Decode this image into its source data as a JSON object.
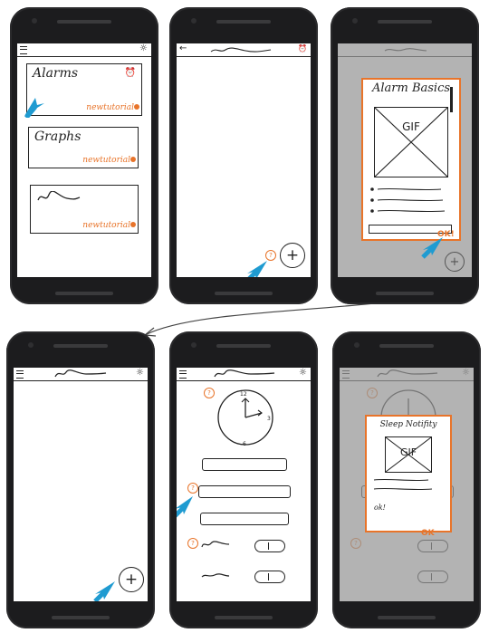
{
  "colors": {
    "accent": "#e8742a",
    "cursor": "#1f9bd1",
    "ink": "#222222",
    "overlay": "#969696"
  },
  "phone1": {
    "cards": [
      {
        "title": "Alarms",
        "link": "newtutorial",
        "icon": "alarm-clock-icon"
      },
      {
        "title": "Graphs",
        "link": "newtutorial"
      },
      {
        "title": "",
        "link": "newtutorial"
      }
    ]
  },
  "phone2": {
    "help": "?",
    "fab": "+"
  },
  "phone3": {
    "modal_title": "Alarm Basics",
    "gif": "GIF",
    "ok": "OK!",
    "fab": "+"
  },
  "phone4": {
    "fab": "+"
  },
  "phone5": {
    "help": "?",
    "clock_numbers": [
      "12",
      "3",
      "6"
    ]
  },
  "phone6": {
    "modal_title": "Sleep Notifity",
    "gif": "GIF",
    "body_text": "ok!",
    "ok": "OK",
    "help": "?"
  }
}
